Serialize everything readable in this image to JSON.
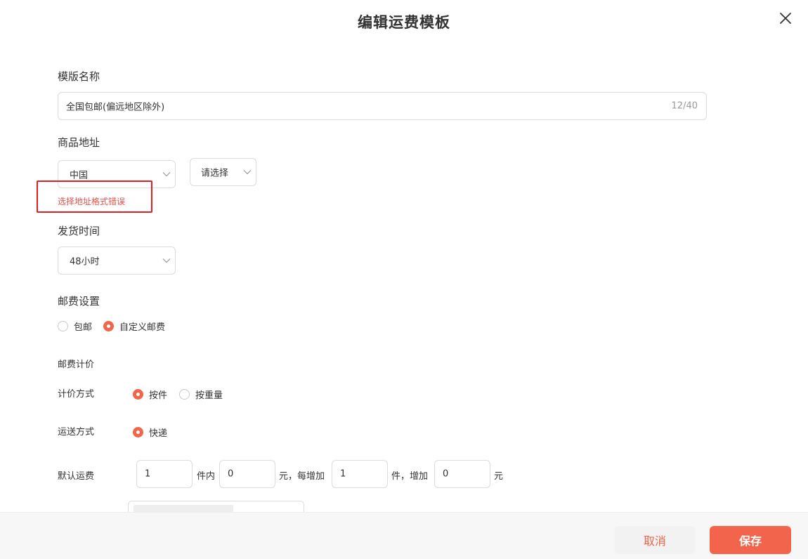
{
  "modal": {
    "title": "编辑运费模板"
  },
  "template_name": {
    "label": "模版名称",
    "value": "全国包邮(偏远地区除外)",
    "counter": "12/40"
  },
  "goods_address": {
    "label": "商品地址",
    "country": "中国",
    "region_placeholder": "请选择",
    "error": "选择地址格式错误"
  },
  "ship_time": {
    "label": "发货时间",
    "value": "48小时"
  },
  "postage": {
    "label": "邮费设置",
    "options": [
      "包邮",
      "自定义邮费"
    ],
    "selected": "自定义邮费"
  },
  "pricing": {
    "section_label": "邮费计价",
    "method_label": "计价方式",
    "method_options": [
      "按件",
      "按重量"
    ],
    "method_selected": "按件",
    "delivery_label": "运送方式",
    "delivery_option": "快递",
    "default_label": "默认运费",
    "first_qty": "1",
    "first_unit": "件内",
    "first_fee": "0",
    "per_add_text": "元，每增加",
    "add_qty": "1",
    "add_unit": "件，增加",
    "add_fee": "0",
    "yuan": "元"
  },
  "footer": {
    "cancel": "取消",
    "save": "保存"
  },
  "colors": {
    "accent": "#f2644b",
    "error": "#e8544a",
    "highlight_border": "#e02020"
  }
}
